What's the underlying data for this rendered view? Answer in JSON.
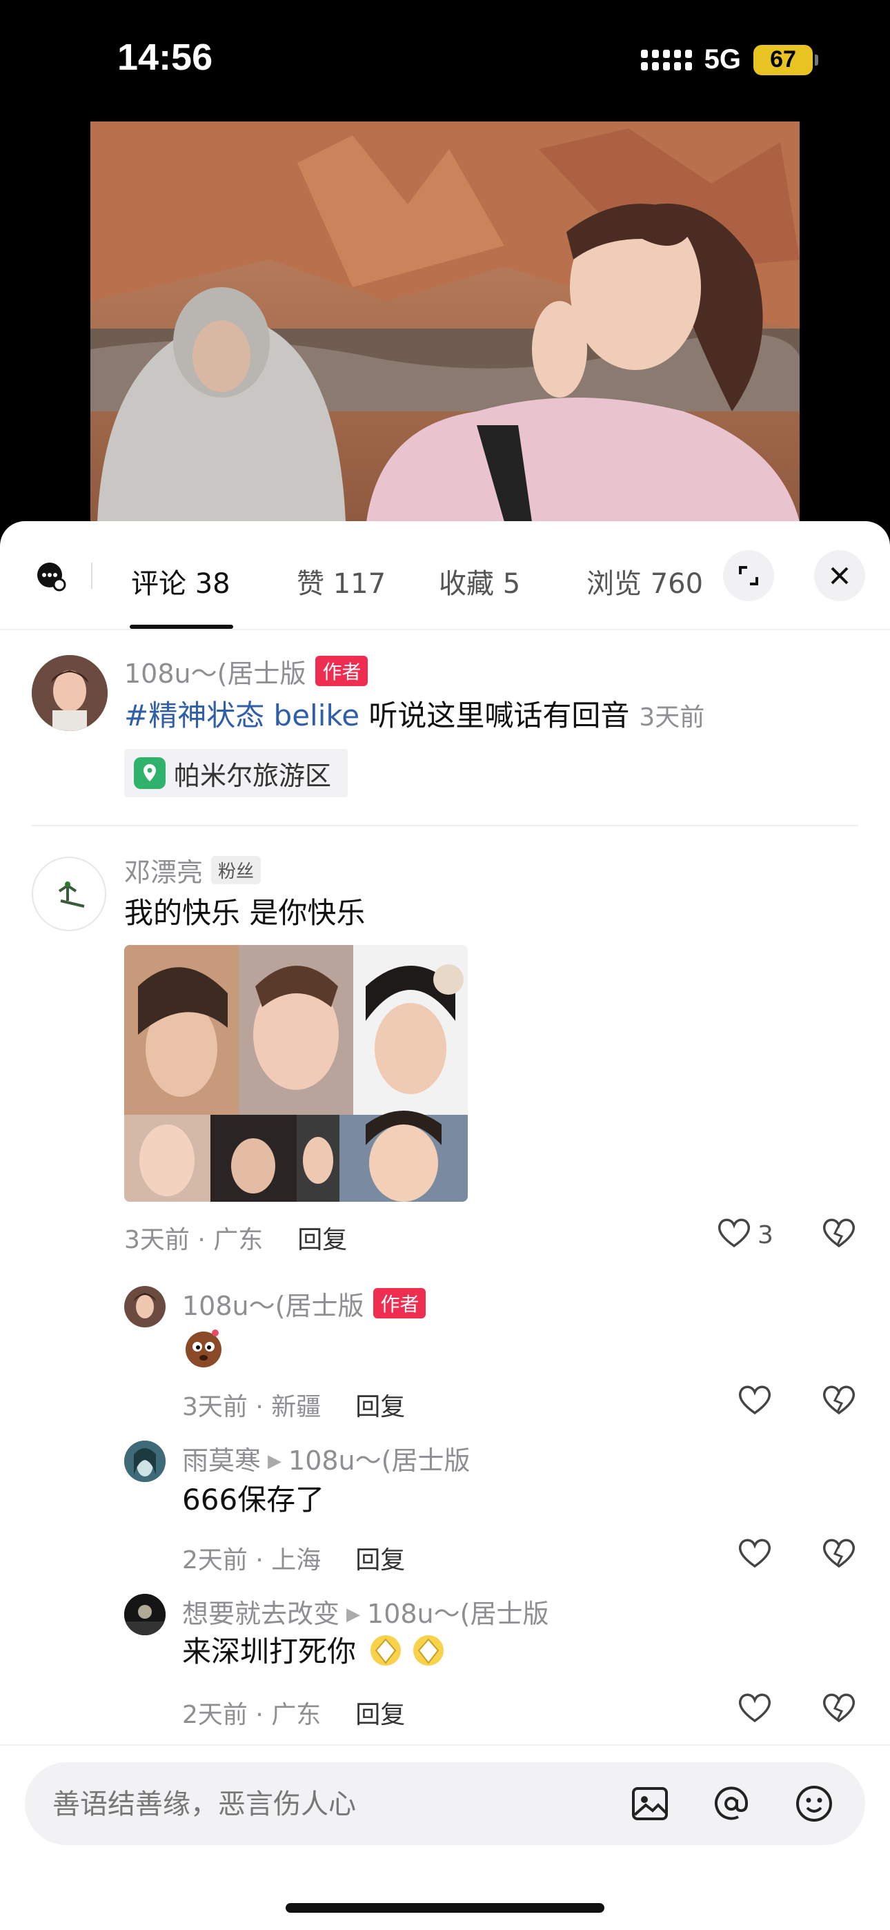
{
  "status_bar": {
    "time": "14:56",
    "network": "5G",
    "battery": "67"
  },
  "tabs": {
    "comments": "评论 38",
    "likes": "赞 117",
    "favorites": "收藏 5",
    "views": "浏览 760"
  },
  "post": {
    "author": "108u～(居士版",
    "author_badge": "作者",
    "hashtag": "#精神状态 belike",
    "text": " 听说这里喊话有回音",
    "time": "3天前",
    "location": "帕米尔旅游区"
  },
  "comments": [
    {
      "user": "邓漂亮",
      "badge": "粉丝",
      "text": "我的快乐  是你快乐",
      "meta": "3天前 · 广东",
      "reply_label": "回复",
      "likes": "3",
      "replies": [
        {
          "user": "108u～(居士版",
          "badge": "作者",
          "text": "",
          "meta": "3天前 · 新疆",
          "reply_label": "回复"
        },
        {
          "user": "雨莫寒",
          "to": "108u～(居士版",
          "text": "666保存了",
          "meta": "2天前 · 上海",
          "reply_label": "回复"
        },
        {
          "user": "想要就去改变",
          "to": "108u～(居士版",
          "text": "来深圳打死你",
          "meta": "2天前 · 广东",
          "reply_label": "回复"
        }
      ]
    }
  ],
  "input": {
    "placeholder": "善语结善缘，恶言伤人心"
  },
  "colors": {
    "accent_red": "#ee2d50",
    "hashtag_blue": "#2f5fa8",
    "battery": "#e8c423"
  }
}
